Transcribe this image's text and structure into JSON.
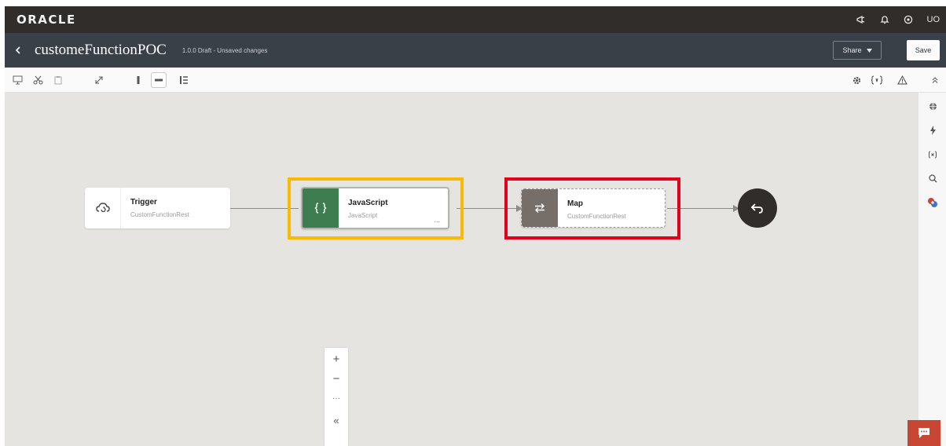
{
  "brand": {
    "logo_text": "ORACLE",
    "user_initials": "UO"
  },
  "header": {
    "title": "customeFunctionPOC",
    "status": "1.0.0 Draft - Unsaved changes",
    "share_label": "Share",
    "save_label": "Save"
  },
  "flow": {
    "nodes": [
      {
        "title": "Trigger",
        "subtitle": "CustomFunctionRest",
        "icon": "trigger-rest-icon"
      },
      {
        "title": "JavaScript",
        "subtitle": "JavaScript",
        "icon": "curly-braces-icon",
        "menu": "..."
      },
      {
        "title": "Map",
        "subtitle": "CustomFunctionRest",
        "icon": "map-arrows-icon"
      }
    ],
    "end_icon": "return-arrow-icon"
  },
  "zoom": {
    "zoom_in": "+",
    "zoom_out": "−",
    "more": "···",
    "collapse": "«"
  },
  "colors": {
    "brand_bar": "#312d2a",
    "title_bar": "#3a4048",
    "javascript_node": "#3d7d4f",
    "map_node": "#756e69",
    "highlight_orange": "#fbb903",
    "highlight_red": "#e4001b",
    "chat_button": "#c74634"
  }
}
